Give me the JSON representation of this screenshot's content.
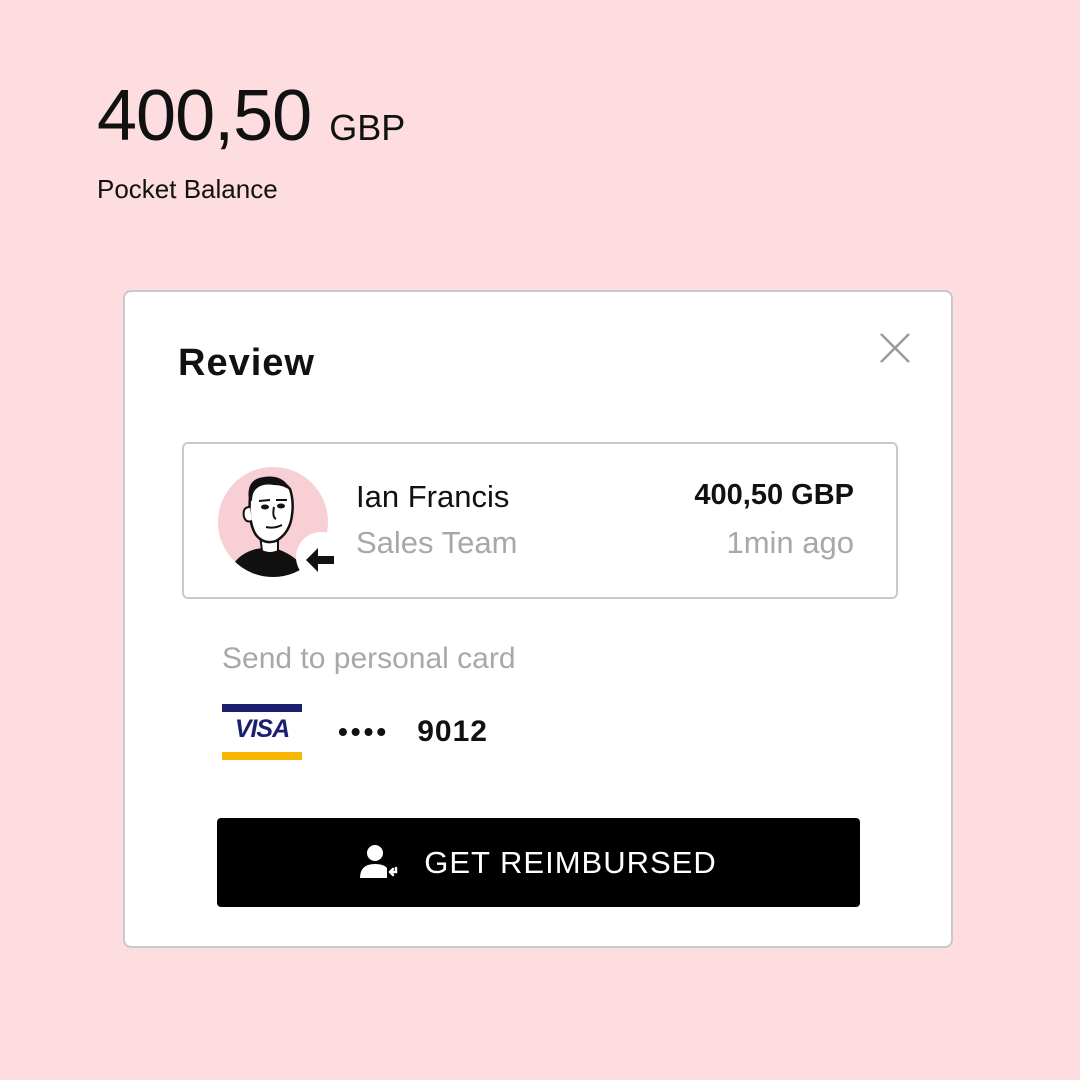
{
  "balance": {
    "amount": "400,50",
    "currency": "GBP",
    "label": "Pocket Balance"
  },
  "modal": {
    "title": "Review",
    "close_icon": "close-icon"
  },
  "request": {
    "name": "Ian Francis",
    "team": "Sales Team",
    "amount": "400,50 GBP",
    "time": "1min ago",
    "avatar_icon": "avatar",
    "direction_icon": "arrow-left-icon"
  },
  "payout": {
    "label": "Send to personal card",
    "card_brand": "VISA",
    "masked": "••••",
    "last4": "9012"
  },
  "action": {
    "label": "GET REIMBURSED",
    "icon": "user-reimburse-icon"
  },
  "colors": {
    "background": "#fddde0",
    "avatar_bg": "#f7cfd4",
    "visa_blue": "#1a1f71",
    "visa_gold": "#f7b600",
    "button_bg": "#000000",
    "muted_text": "#a8a8a8"
  }
}
